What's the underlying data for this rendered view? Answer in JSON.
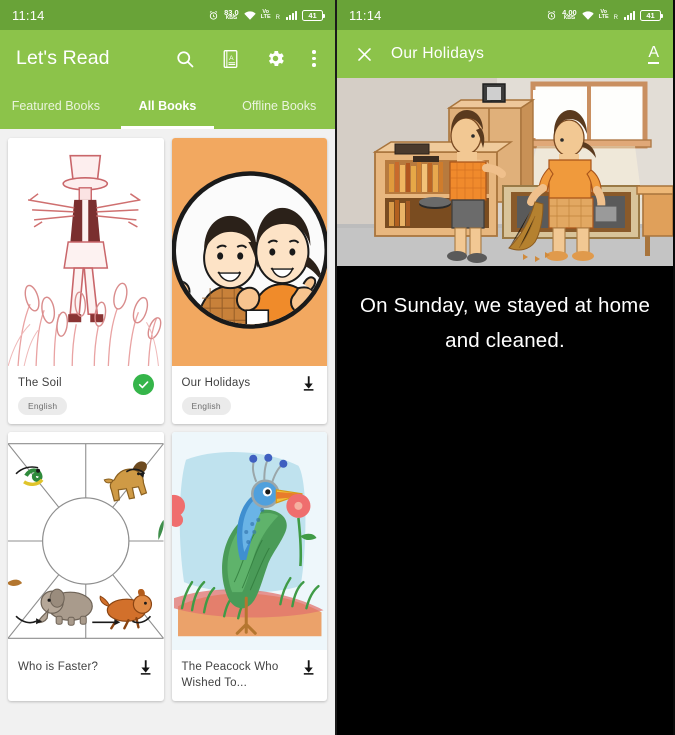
{
  "colors": {
    "accent": "#8cc34a",
    "status_bar": "#69a338",
    "page_bg": "#f1f1f1",
    "card_bg": "#ffffff",
    "downloaded_badge": "#35b54a",
    "reader_bg": "#000000"
  },
  "left_panel": {
    "status_bar": {
      "time": "11:14",
      "alarm_icon": "alarm-icon",
      "network_speed_value": "83.0",
      "network_speed_unit": "KB/S",
      "wifi_icon": "wifi-icon",
      "volte_top": "Vo",
      "volte_bottom": "LTE",
      "roaming_letter": "R",
      "signal_icon": "signal-bars-icon",
      "battery_level": "41"
    },
    "app_bar": {
      "title": "Let's Read",
      "actions": [
        {
          "name": "search-icon",
          "label": "Search"
        },
        {
          "name": "language-book-icon",
          "label": "Language"
        },
        {
          "name": "gear-icon",
          "label": "Settings"
        },
        {
          "name": "overflow-menu-icon",
          "label": "More options"
        }
      ]
    },
    "tabs": [
      {
        "label": "Featured Books",
        "active": false
      },
      {
        "label": "All Books",
        "active": true
      },
      {
        "label": "Offline Books",
        "active": false
      }
    ],
    "books": [
      {
        "title": "The Soil",
        "status": "downloaded",
        "status_icon": "check-circle-icon",
        "language": "English"
      },
      {
        "title": "Our Holidays",
        "status": "download",
        "status_icon": "download-icon",
        "language": "English"
      },
      {
        "title": "Who is Faster?",
        "status": "download",
        "status_icon": "download-icon",
        "language": ""
      },
      {
        "title": "The Peacock Who Wished To...",
        "status": "download",
        "status_icon": "download-icon",
        "language": ""
      }
    ]
  },
  "right_panel": {
    "status_bar": {
      "time": "11:14",
      "network_speed_value": "4.00",
      "network_speed_unit": "KB/S",
      "volte_top": "Vo",
      "volte_bottom": "LTE",
      "roaming_letter": "R",
      "battery_level": "41"
    },
    "reader_bar": {
      "close_icon": "close-icon",
      "title": "Our Holidays",
      "font_size_button": "A"
    },
    "page": {
      "illustration_alt": "Boy dusting a bookshelf while a girl sweeps the floor with a broom",
      "text": "On Sunday, we stayed at home and cleaned."
    }
  }
}
